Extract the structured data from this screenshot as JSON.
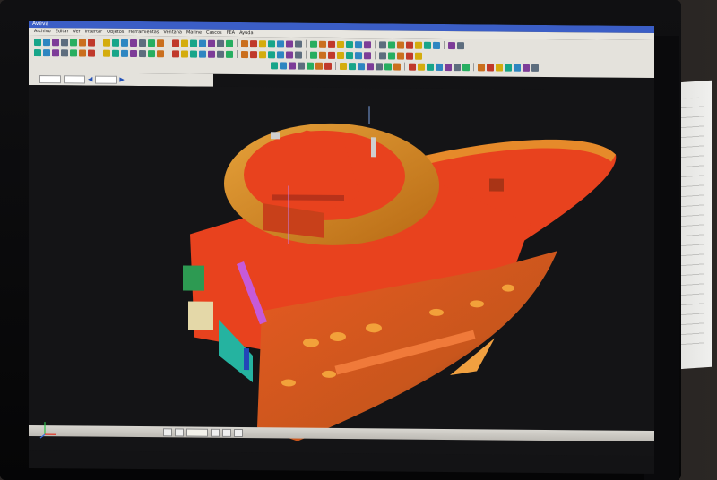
{
  "app": {
    "title": "Aveva"
  },
  "menu": [
    "Archivo",
    "Editar",
    "Ver",
    "Insertar",
    "Objetos",
    "Herramientas",
    "Ventana",
    "Marine",
    "Cascos",
    "FEA",
    "Ayuda"
  ],
  "subtool": {
    "field_a": "",
    "field_b": "",
    "field_c": ""
  },
  "taskbar": {
    "task_label": ""
  },
  "colors": {
    "hull_red": "#e8401c",
    "hull_orange": "#d97a1a",
    "gold_ring": "#d9901e",
    "green": "#2d9a52",
    "cyan": "#25b3a0",
    "viewport_bg": "#141416"
  },
  "icons": [
    "axis-triad-icon",
    "toolbar-tool-icon",
    "arrow-left-icon",
    "arrow-right-icon"
  ]
}
